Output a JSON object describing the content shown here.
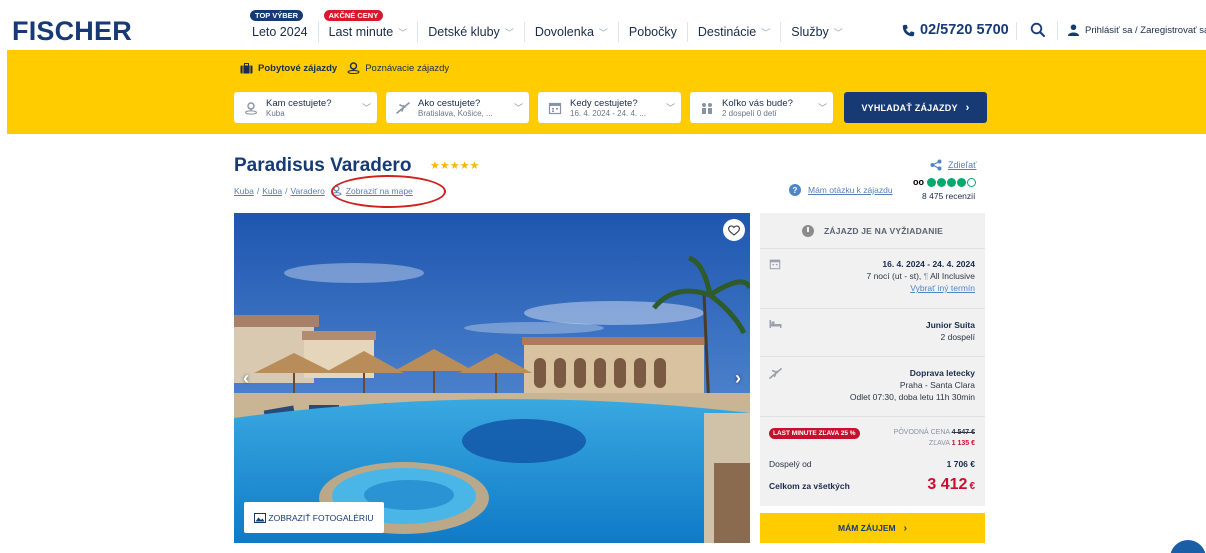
{
  "header": {
    "logo": "FISCHER",
    "nav": [
      {
        "label": "Leto 2024",
        "badge": "TOP VÝBER",
        "badge_color": "#173a75",
        "has_dropdown": false
      },
      {
        "label": "Last minute",
        "badge": "AKČNÉ CENY",
        "badge_color": "#d8182f",
        "has_dropdown": true
      },
      {
        "label": "Detské kluby",
        "has_dropdown": true
      },
      {
        "label": "Dovolenka",
        "has_dropdown": true
      },
      {
        "label": "Pobočky",
        "has_dropdown": false
      },
      {
        "label": "Destinácie",
        "has_dropdown": true
      },
      {
        "label": "Služby",
        "has_dropdown": true
      }
    ],
    "phone": "02/5720 5700",
    "login": "Prihlásiť sa / Zaregistrovať sa"
  },
  "search_band": {
    "tabs": [
      {
        "label": "Pobytové zájazdy",
        "active": true,
        "icon": "suitcase-icon"
      },
      {
        "label": "Poznávacie zájazdy",
        "active": false,
        "icon": "map-pin-icon"
      }
    ],
    "fields": [
      {
        "label": "Kam cestujete?",
        "value": "Kuba",
        "icon": "location-icon"
      },
      {
        "label": "Ako cestujete?",
        "value": "Bratislava, Košice, ...",
        "icon": "plane-icon"
      },
      {
        "label": "Kedy cestujete?",
        "value": "16. 4. 2024 - 24. 4. ...",
        "icon": "calendar-icon"
      },
      {
        "label": "Koľko vás bude?",
        "value": "2 dospelí 0 detí",
        "icon": "people-icon"
      }
    ],
    "search_button": "VYHĽADAŤ ZÁJAZDY"
  },
  "hotel": {
    "name": "Paradisus Varadero",
    "stars": "★★★★★",
    "breadcrumb": [
      "Kuba",
      "Kuba",
      "Varadero"
    ],
    "map_link": "Zobraziť na mape",
    "share": "Zdieľať",
    "question": "Mám otázku k zájazdu",
    "rating_dots": 4,
    "reviews": "8 475 recenzií",
    "gallery_button": "ZOBRAZIŤ FOTOGALÉRIU"
  },
  "booking": {
    "status": "ZÁJAZD JE NA VYŽIADANIE",
    "dates": "16. 4. 2024 - 24. 4. 2024",
    "nights": "7 nocí (ut - st), ",
    "board": "All Inclusive",
    "change_date": "Vybrať iný termín",
    "room": "Junior Suita",
    "persons": "2 dospelí",
    "transport": "Doprava letecky",
    "route": "Praha - Santa Clara",
    "departure": "Odlet 07:30, doba letu 11h 30min",
    "discount_badge": "LAST MINUTE ZĽAVA 25 %",
    "original_price_label": "PÔVODNÁ CENA",
    "original_price": "4 547 €",
    "discount_label": "ZĽAVA",
    "discount": "1 135 €",
    "adult_label": "Dospelý od",
    "adult_price": "1 706 €",
    "total_label": "Celkom za všetkých",
    "total_price": "3 412",
    "currency": "€",
    "interest_button": "MÁM ZÁUJEM"
  },
  "colors": {
    "brand_blue": "#173a75",
    "brand_yellow": "#ffcc00",
    "accent_red": "#c8102e",
    "link_blue": "#5a7fb8"
  }
}
